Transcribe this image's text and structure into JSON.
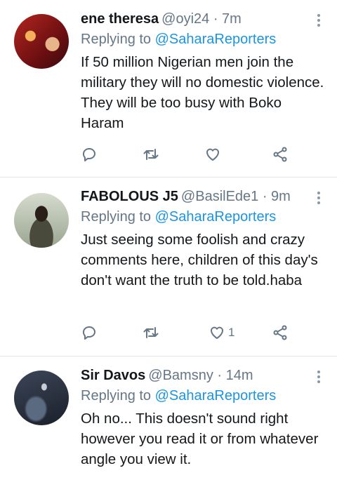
{
  "tweets": [
    {
      "name": "ene theresa",
      "handle": "@oyi24 · 7m",
      "reply_prefix": "Replying to",
      "reply_to": "@SaharaReporters",
      "text": "If 50 million Nigerian men join the military they will no domestic violence. They will be too busy with Boko Haram",
      "like_count": ""
    },
    {
      "name": "FABOLOUS J5",
      "handle": "@BasilEde1 · 9m",
      "reply_prefix": "Replying to",
      "reply_to": "@SaharaReporters",
      "text": "Just seeing some foolish and crazy comments here, children of this day's don't want the truth to be told.haba",
      "like_count": "1"
    },
    {
      "name": "Sir Davos",
      "handle": "@Bamsny · 14m",
      "reply_prefix": "Replying to",
      "reply_to": "@SaharaReporters",
      "text": "Oh no... This doesn't sound right however you read it or from whatever angle you view it.",
      "like_count": ""
    }
  ],
  "icons": [
    "reply-icon",
    "retweet-icon",
    "like-icon",
    "share-icon",
    "more-icon"
  ],
  "colors": {
    "link": "#1b95e0",
    "muted": "#657786",
    "divider": "#e1e8ed"
  }
}
